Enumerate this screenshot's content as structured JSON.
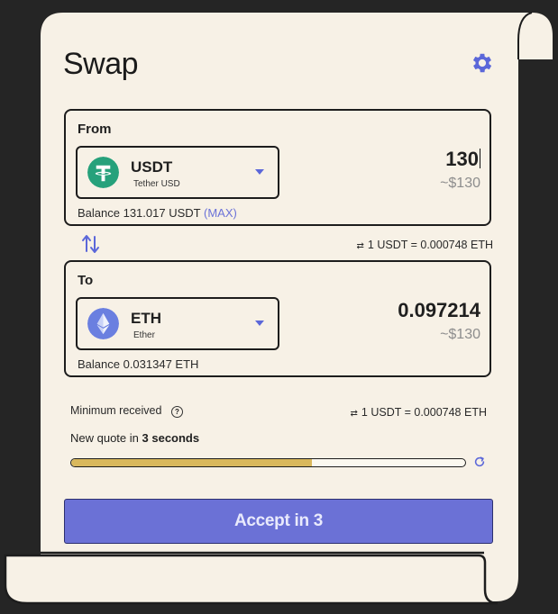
{
  "title": "Swap",
  "icons": {
    "settings": "gear-icon",
    "swap_direction": "swap-arrows-icon",
    "help": "help-icon",
    "refresh": "refresh-icon"
  },
  "colors": {
    "background": "#252525",
    "paper": "#f7f1e6",
    "accent": "#6b71d6",
    "usdt_logo": "#26a17b",
    "eth_logo": "#6a7fe0",
    "progress": "#d9b85c"
  },
  "from": {
    "label": "From",
    "token_symbol": "USDT",
    "token_name": "Tether USD",
    "amount": "130",
    "usd_value": "~$130",
    "balance_text": "Balance 131.017 USDT",
    "max_label": "(MAX)"
  },
  "rate_top": "1 USDT = 0.000748 ETH",
  "to": {
    "label": "To",
    "token_symbol": "ETH",
    "token_name": "Ether",
    "amount": "0.097214",
    "usd_value": "~$130",
    "balance_text": "Balance 0.031347 ETH"
  },
  "summary": {
    "minimum_received_label": "Minimum received",
    "rate": "1 USDT = 0.000748 ETH",
    "quote_prefix": "New quote in",
    "quote_countdown": "3 seconds",
    "progress": 0.61
  },
  "accept_button": "Accept in 3"
}
